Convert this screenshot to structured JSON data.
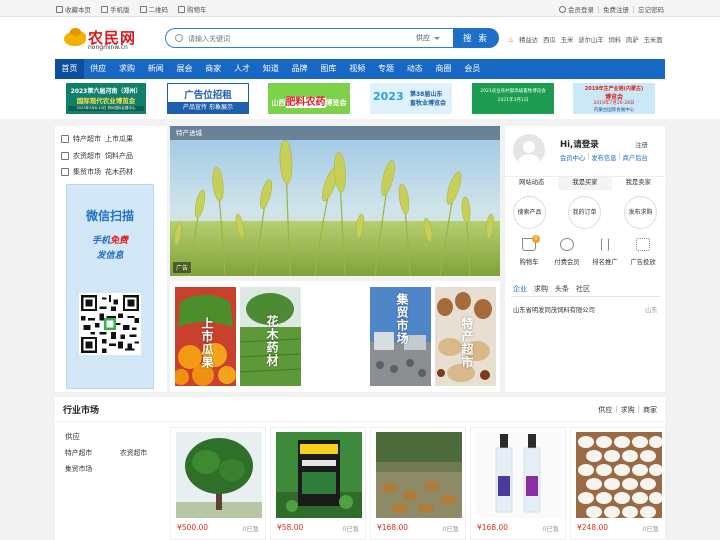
{
  "topbar": {
    "left": [
      {
        "label": "收藏本页",
        "icon": "star-icon"
      },
      {
        "label": "手机版",
        "icon": "phone-icon"
      },
      {
        "label": "二维码",
        "icon": "qrcode-icon"
      },
      {
        "label": "购物车",
        "icon": "cart-icon"
      }
    ],
    "right": [
      {
        "label": "会员登录",
        "icon": "user-icon"
      },
      {
        "label": "免费注册"
      },
      {
        "label": "忘记密码"
      }
    ]
  },
  "logo": {
    "cn": "农民网",
    "en": "nongminw.cn"
  },
  "search": {
    "placeholder": "请输入关键词",
    "category": "供应",
    "button": "搜 索"
  },
  "hot_keywords": [
    "精益达",
    "西瓜",
    "玉米",
    "波尔山羊",
    "饲料",
    "肉驴",
    "玉米面"
  ],
  "nav": [
    "首页",
    "供应",
    "求购",
    "新闻",
    "展会",
    "商家",
    "人才",
    "知道",
    "品牌",
    "图库",
    "视频",
    "专题",
    "动态",
    "商圈",
    "会员"
  ],
  "ads": {
    "ad1": {
      "line1": "2023第六届河南（郑州）",
      "line2": "国际现代农业博览会",
      "line3": "2023年3月8-10日 郑州国际会展中心"
    },
    "ad2": {
      "title": "广告位招租",
      "sub": "产品宣传 形象展示"
    },
    "ad3": {
      "left": "山西",
      "mid": "肥料农药",
      "right": "博览会"
    },
    "ad4": {
      "year": "2023",
      "title": "第38届山东",
      "sub": "畜牧业博览会"
    },
    "ad5": {
      "line1": "2021农业农村部高级畜牧博览会",
      "line2": "2021年3月1日"
    },
    "ad6": {
      "line1": "2019年生产业链(内蒙古)",
      "line2": "博览会",
      "line3": "2019年7月26-28日",
      "line4": "内蒙古国际会展中心"
    }
  },
  "categories": [
    {
      "icon": "list-icon",
      "a": "特产超市",
      "b": "上市瓜果"
    },
    {
      "icon": "grid-icon",
      "a": "农资超市",
      "b": "饲料产品"
    },
    {
      "icon": "list-icon",
      "a": "集贸市场",
      "b": "花木药材"
    }
  ],
  "wechat": {
    "title": "微信扫描",
    "line1a": "手机",
    "line1b": "免费",
    "line2": "发信息"
  },
  "banner": {
    "label": "特产进城",
    "ad_tag": "广告"
  },
  "tiles": [
    "上市瓜果",
    "花木药材",
    "集贸市场",
    "特产超市"
  ],
  "user": {
    "greeting": "Hi,请登录",
    "register": "注册",
    "links": [
      "会员中心",
      "发布信息",
      "商户后台"
    ],
    "tabs": [
      "网站动态",
      "我是买家",
      "我是卖家"
    ],
    "circles": [
      "搜索产品",
      "我的订单",
      "发布求购"
    ],
    "tools": [
      {
        "label": "购物车",
        "icon": "cart-icon",
        "badge": "0"
      },
      {
        "label": "付费会员",
        "icon": "vip-icon"
      },
      {
        "label": "排名推广",
        "icon": "rank-icon"
      },
      {
        "label": "广告投放",
        "icon": "ad-icon"
      }
    ]
  },
  "news": {
    "tabs": [
      "企业",
      "求购",
      "头条",
      "社区"
    ],
    "item": "山东省明发同茂饲料有限公司",
    "region": "山东"
  },
  "market": {
    "title": "行业市场",
    "tabs": [
      "供应",
      "求购",
      "商家"
    ],
    "left_title": "供应",
    "left_items": [
      "特产超市",
      "农资超市",
      "集贸市场"
    ],
    "products": [
      {
        "price": "¥500.00",
        "sold": "0已售"
      },
      {
        "price": "¥58.00",
        "sold": "0已售"
      },
      {
        "price": "¥168.00",
        "sold": "0已售"
      },
      {
        "price": "¥168.00",
        "sold": "0已售"
      },
      {
        "price": "¥248.00",
        "sold": "0已售"
      }
    ]
  },
  "colors": {
    "brand": "#1768c4",
    "accent_red": "#e0311a",
    "logo_red": "#d71920"
  }
}
